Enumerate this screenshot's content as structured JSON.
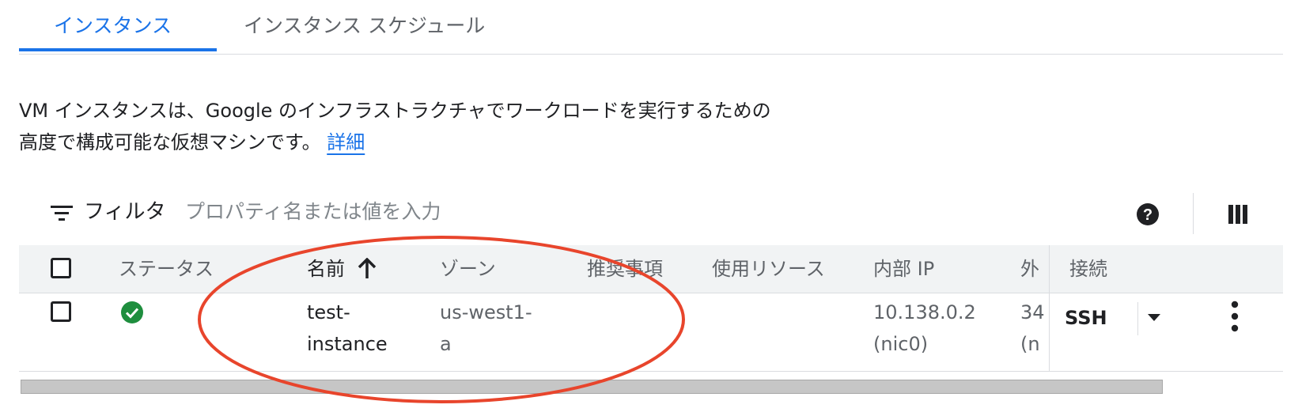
{
  "tabs": [
    {
      "label": "インスタンス",
      "active": true
    },
    {
      "label": "インスタンス スケジュール",
      "active": false
    }
  ],
  "description": {
    "line1": "VM インスタンスは、Google のインフラストラクチャでワークロードを実行するための",
    "line2": "高度で構成可能な仮想マシンです。",
    "link": "詳細"
  },
  "filter": {
    "label": "フィルタ",
    "placeholder": "プロパティ名または値を入力",
    "icon": "filter-list-icon"
  },
  "toolbar": {
    "help_icon": "help-icon",
    "columns_icon": "column-display-icon"
  },
  "table": {
    "headers": {
      "status": "ステータス",
      "name": "名前",
      "zone": "ゾーン",
      "recommendations": "推奨事項",
      "in_use_by": "使用リソース",
      "internal_ip": "内部 IP",
      "external_ip": "外",
      "connect": "接続"
    },
    "sort": {
      "column": "name",
      "direction": "ascending",
      "icon": "arrow-up-icon"
    },
    "rows": [
      {
        "status": "running",
        "status_icon": "check-circle-icon",
        "name_line1": "test-",
        "name_line2": "instance",
        "zone_line1": "us-west1-",
        "zone_line2": "a",
        "recommendations": "",
        "in_use_by": "",
        "internal_ip_line1": "10.138.0.2",
        "internal_ip_line2": "(nic0)",
        "external_ip_line1": "34",
        "external_ip_line2": "(n",
        "connect": "SSH"
      }
    ]
  },
  "colors": {
    "accent": "#1a73e8",
    "status_ok": "#1e8e3e",
    "annotation": "#e8452c"
  }
}
